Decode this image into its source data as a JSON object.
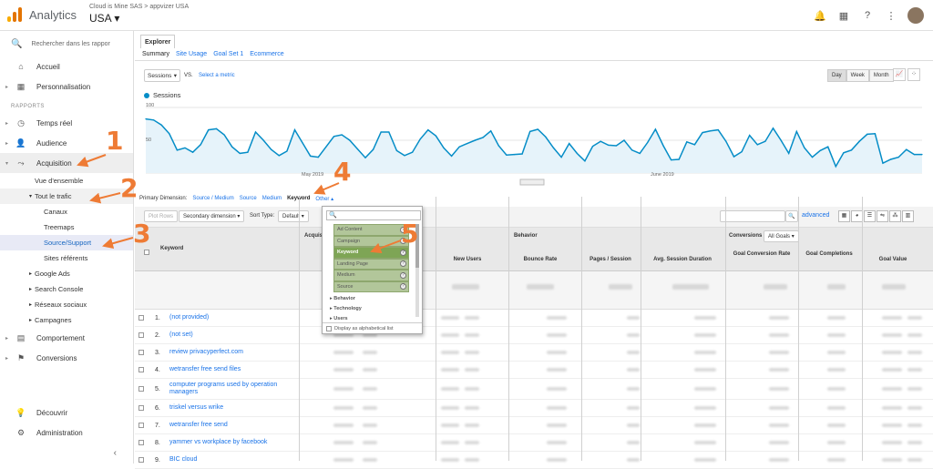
{
  "topbar": {
    "app_title": "Analytics",
    "account_crumb": "Cloud is Mine SAS > appvizer USA",
    "account_name": "USA",
    "icons": [
      "bell-icon",
      "apps-grid-icon",
      "help-icon",
      "more-vert-icon",
      "avatar"
    ]
  },
  "sidebar": {
    "search_placeholder": "Rechercher dans les rappor",
    "top_items": [
      "Accueil",
      "Personnalisation"
    ],
    "reports_label": "RAPPORTS",
    "report_items": [
      "Temps réel",
      "Audience",
      "Acquisition"
    ],
    "acq_sub": [
      "Vue d'ensemble",
      "Tout le trafic"
    ],
    "traffic_sub": [
      "Canaux",
      "Treemaps",
      "Source/Support",
      "Sites référents"
    ],
    "acq_sub2": [
      "Google Ads",
      "Search Console",
      "Réseaux sociaux",
      "Campagnes"
    ],
    "other_items": [
      "Comportement",
      "Conversions"
    ],
    "bottom_items": [
      "Découvrir",
      "Administration"
    ]
  },
  "explorer": {
    "tab": "Explorer",
    "subtabs": [
      "Summary",
      "Site Usage",
      "Goal Set 1",
      "Ecommerce"
    ],
    "metric": "Sessions",
    "vs": "VS.",
    "select_metric": "Select a metric",
    "ranges": [
      "Day",
      "Week",
      "Month"
    ]
  },
  "chart_data": {
    "type": "line",
    "series": [
      {
        "name": "Sessions",
        "values": [
          99,
          97,
          88,
          72,
          42,
          46,
          38,
          52,
          79,
          81,
          70,
          48,
          36,
          38,
          75,
          60,
          43,
          32,
          40,
          79,
          55,
          31,
          29,
          48,
          67,
          70,
          60,
          44,
          28,
          43,
          75,
          75,
          41,
          32,
          38,
          62,
          79,
          68,
          46,
          31,
          48,
          54,
          60,
          65,
          77,
          50,
          33,
          34,
          35,
          76,
          80,
          66,
          46,
          29,
          54,
          36,
          22,
          49,
          58,
          51,
          50,
          60,
          42,
          36,
          56,
          80,
          50,
          24,
          25,
          57,
          52,
          74,
          77,
          79,
          58,
          30,
          39,
          69,
          52,
          58,
          82,
          60,
          36,
          76,
          46,
          29,
          41,
          48,
          12,
          37,
          42,
          58,
          71,
          72,
          18,
          25,
          29,
          43,
          34,
          34
        ]
      }
    ],
    "x_labels": [
      "May 2019",
      "June 2019"
    ],
    "y_ticks": [
      "100",
      "50"
    ],
    "ylim": [
      0,
      120
    ],
    "grid": true
  },
  "primary_dimension": {
    "label": "Primary Dimension:",
    "options": [
      "Source / Medium",
      "Source",
      "Medium",
      "Keyword",
      "Other"
    ]
  },
  "controls": {
    "plot_rows": "Plot Rows",
    "secondary_dim": "Secondary dimension",
    "sort_label": "Sort Type:",
    "sort_value": "Default",
    "advanced": "advanced"
  },
  "table": {
    "col_keyword": "Keyword",
    "group_acquisition": "Acquis",
    "group_behavior": "Behavior",
    "group_conversions": "Conversions",
    "goals_select": "All Goals",
    "headers": [
      "New Users",
      "Bounce Rate",
      "Pages / Session",
      "Avg. Session Duration",
      "Goal Conversion Rate",
      "Goal Completions",
      "Goal Value"
    ],
    "rows": [
      {
        "num": "1.",
        "keyword": "(not provided)"
      },
      {
        "num": "2.",
        "keyword": "(not set)"
      },
      {
        "num": "3.",
        "keyword": "review privacyperfect.com"
      },
      {
        "num": "4.",
        "keyword": "wetransfer free send files"
      },
      {
        "num": "5.",
        "keyword": "computer programs used by operation managers"
      },
      {
        "num": "6.",
        "keyword": "triskel versus wrike"
      },
      {
        "num": "7.",
        "keyword": "wetransfer free send"
      },
      {
        "num": "8.",
        "keyword": "yammer vs workplace by facebook"
      },
      {
        "num": "9.",
        "keyword": "BIC cloud"
      }
    ]
  },
  "dropdown": {
    "items": [
      "Ad Content",
      "Campaign",
      "Keyword",
      "Landing Page",
      "Medium",
      "Source"
    ],
    "selected": "Keyword",
    "categories": [
      "Behavior",
      "Technology",
      "Users"
    ],
    "footer": "Display as alphabetical list"
  },
  "annotations": [
    "1",
    "2",
    "3",
    "4",
    "5"
  ],
  "colors": {
    "accent": "#058dc7",
    "arrow": "#ee7b35",
    "link": "#1a73e8"
  }
}
